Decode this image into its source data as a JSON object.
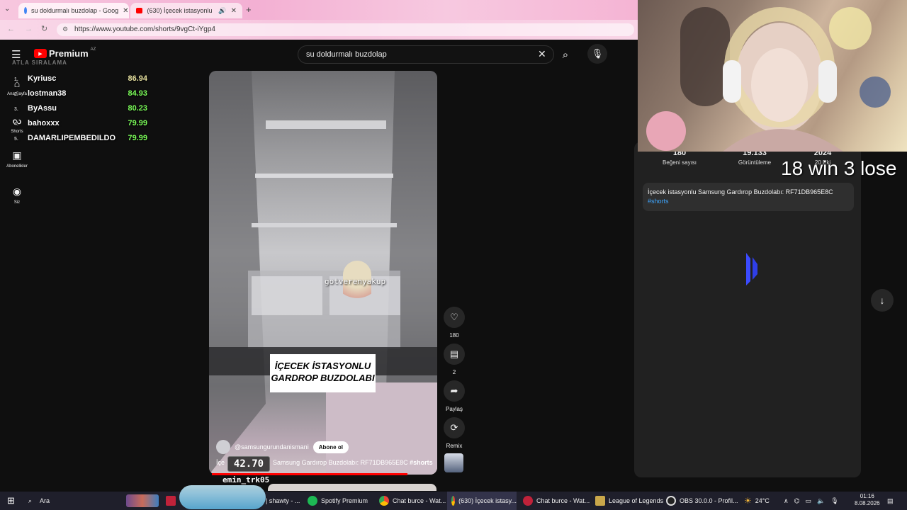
{
  "browser": {
    "tabs": [
      {
        "label": "su doldurmalı buzdolap - Goog"
      },
      {
        "label": "(630) İçecek istasyonlu San"
      }
    ],
    "url": "https://www.youtube.com/shorts/9vgCt-iYgp4"
  },
  "youtube": {
    "logo_text": "Premium",
    "region": "AZ",
    "search_value": "su doldurmalı buzdolap",
    "sidebar": [
      {
        "label": "Ana Sayfa",
        "icon": "home-icon"
      },
      {
        "label": "Shorts",
        "icon": "shorts-icon"
      },
      {
        "label": "Abonelikler",
        "icon": "subscriptions-icon"
      },
      {
        "label": "Siz",
        "icon": "account-icon"
      }
    ]
  },
  "leaderboard": {
    "title": "ATLA SIRALAMA",
    "rows": [
      {
        "rank": "1.",
        "name": "Kyriusc",
        "score": "86.94",
        "color": "#e8e2a0"
      },
      {
        "rank": "2.",
        "name": "lostman38",
        "score": "84.93",
        "color": "#7cff5a"
      },
      {
        "rank": "3.",
        "name": "ByAssu",
        "score": "80.23",
        "color": "#7cff5a"
      },
      {
        "rank": "4.",
        "name": "bahoxxx",
        "score": "79.99",
        "color": "#7cff5a"
      },
      {
        "rank": "5.",
        "name": "DAMARLIPEMBEDILDO",
        "score": "79.99",
        "color": "#7cff5a"
      }
    ]
  },
  "short": {
    "caption": "İÇECEK İSTASYONLU GARDROP BUZDOLABI",
    "overlay_user": "gotverenyakup",
    "channel": "@samsungurundanismani",
    "subscribe_label": "Abone ol",
    "title_prefix": "İçe",
    "title_suffix": "Samsung Gardırop Buzdolabı: RF71DB965E8C",
    "title_tag": "#shorts",
    "timer": "42.70",
    "viewer": "emin_trk05"
  },
  "actions": [
    {
      "label": "180",
      "icon": "like-icon"
    },
    {
      "label": "2",
      "icon": "comment-icon"
    },
    {
      "label": "Paylaş",
      "icon": "share-icon"
    },
    {
      "label": "Remix",
      "icon": "remix-icon"
    }
  ],
  "description": {
    "stats": [
      {
        "value": "180",
        "label": "Beğeni sayısı"
      },
      {
        "value": "19.133",
        "label": "Görüntüleme"
      },
      {
        "value": "2024",
        "label": "20 Eki"
      }
    ],
    "text": "İçecek istasyonlu Samsung Gardırop Buzdolabı: RF71DB965E8C",
    "tag": "#shorts"
  },
  "stream_overlay": {
    "score": "18 win 3 lose"
  },
  "taskbar": {
    "search_label": "Ara",
    "items": [
      {
        "label": "| shawty - ...",
        "color": "#2e6bd6"
      },
      {
        "label": "Spotify Premium",
        "color": "#1db954"
      },
      {
        "label": "Chat burce - Wat...",
        "color": "#e8b53a"
      },
      {
        "label": "(630) İçecek istasy...",
        "color": "#e8b53a"
      },
      {
        "label": "Chat burce - Wat...",
        "color": "#c0223a"
      },
      {
        "label": "League of Legends",
        "color": "#c9a74a"
      },
      {
        "label": "OBS 30.0.0 - Profil...",
        "color": "#444"
      }
    ],
    "weather": "24°C",
    "time": "01:16",
    "date": "8.08.2026"
  }
}
